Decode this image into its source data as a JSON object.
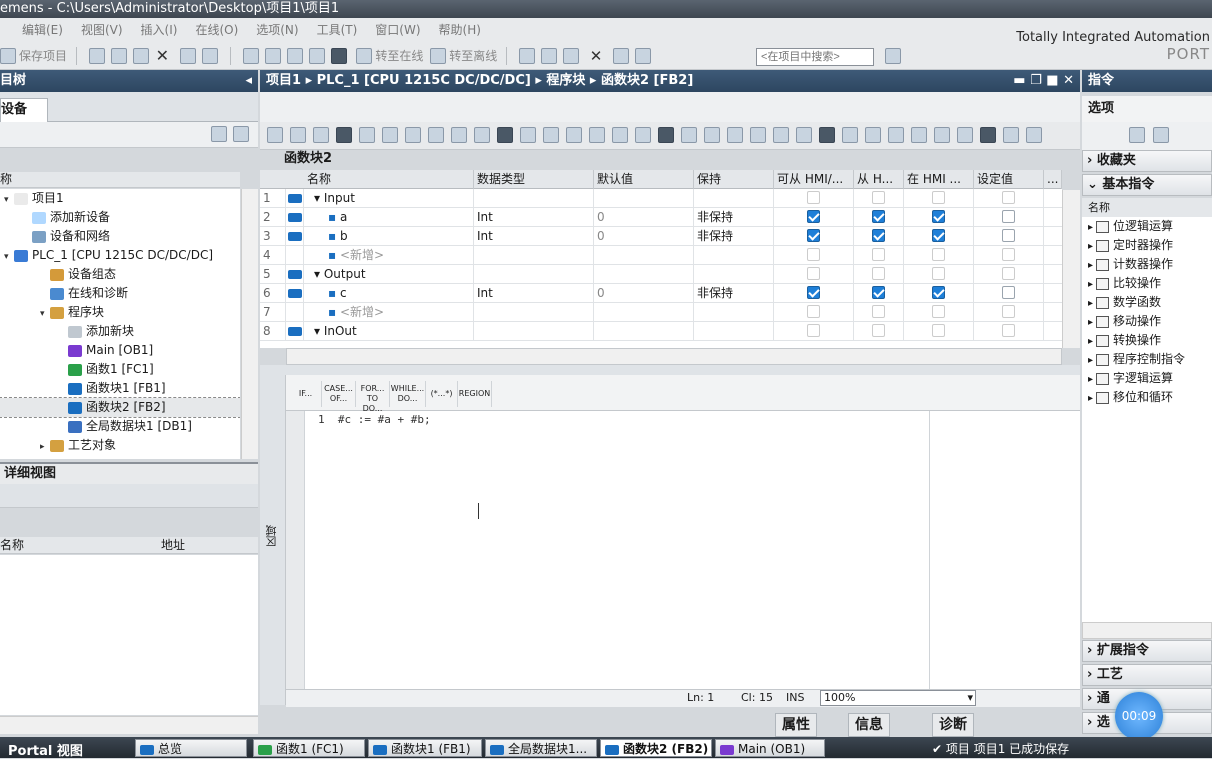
{
  "window": {
    "title": "emens  -  C:\\Users\\Administrator\\Desktop\\项目1\\项目1"
  },
  "menu": [
    "编辑(E)",
    "视图(V)",
    "插入(I)",
    "在线(O)",
    "选项(N)",
    "工具(T)",
    "窗口(W)",
    "帮助(H)"
  ],
  "toolbar": {
    "save_label": "保存项目",
    "go_online": "转至在线",
    "go_offline": "转至离线",
    "search_placeholder": "<在项目中搜索>"
  },
  "brand": {
    "line1": "Totally Integrated Automation",
    "line2": "PORT"
  },
  "left": {
    "header": "目树",
    "tab": "设备",
    "col_name": "称",
    "tree": [
      {
        "label": "项目1"
      },
      {
        "label": "添加新设备"
      },
      {
        "label": "设备和网络"
      },
      {
        "label": "PLC_1 [CPU 1215C DC/DC/DC]"
      },
      {
        "label": "设备组态"
      },
      {
        "label": "在线和诊断"
      },
      {
        "label": "程序块"
      },
      {
        "label": "添加新块"
      },
      {
        "label": "Main [OB1]"
      },
      {
        "label": "函数1 [FC1]"
      },
      {
        "label": "函数块1 [FB1]"
      },
      {
        "label": "函数块2 [FB2]"
      },
      {
        "label": "全局数据块1 [DB1]"
      },
      {
        "label": "工艺对象"
      }
    ],
    "detail": {
      "header": "详细视图",
      "col_name": "名称",
      "col_addr": "地址"
    }
  },
  "editor": {
    "breadcrumb": "项目1 ▸ PLC_1 [CPU 1215C DC/DC/DC] ▸ 程序块 ▸ 函数块2 [FB2]",
    "block_title": "函数块2",
    "columns": [
      "名称",
      "数据类型",
      "默认值",
      "保持",
      "可从 HMI/...",
      "从 H...",
      "在 HMI ...",
      "设定值",
      "..."
    ],
    "rows": [
      {
        "n": "1",
        "name": "Input",
        "type": "",
        "def": "",
        "ret": "",
        "c1": false,
        "c2": false,
        "c3": false,
        "sec": true
      },
      {
        "n": "2",
        "name": "a",
        "type": "Int",
        "def": "0",
        "ret": "非保持",
        "c1": true,
        "c2": true,
        "c3": true
      },
      {
        "n": "3",
        "name": "b",
        "type": "Int",
        "def": "0",
        "ret": "非保持",
        "c1": true,
        "c2": true,
        "c3": true
      },
      {
        "n": "4",
        "name": "<新增>",
        "type": "",
        "def": "",
        "ret": "",
        "c1": false,
        "c2": false,
        "c3": false,
        "add": true
      },
      {
        "n": "5",
        "name": "Output",
        "type": "",
        "def": "",
        "ret": "",
        "c1": false,
        "c2": false,
        "c3": false,
        "sec": true
      },
      {
        "n": "6",
        "name": "c",
        "type": "Int",
        "def": "0",
        "ret": "非保持",
        "c1": true,
        "c2": true,
        "c3": true
      },
      {
        "n": "7",
        "name": "<新增>",
        "type": "",
        "def": "",
        "ret": "",
        "c1": false,
        "c2": false,
        "c3": false,
        "add": true
      },
      {
        "n": "8",
        "name": "InOut",
        "type": "",
        "def": "",
        "ret": "",
        "c1": false,
        "c2": false,
        "c3": false,
        "sec": true
      }
    ],
    "scl_buttons": [
      "IF...",
      "CASE... OF...",
      "FOR... TO DO...",
      "WHILE... DO...",
      "(*...*)",
      "REGION"
    ],
    "code_line_no": "1",
    "code": "#c := #a + #b;",
    "side_label": "区域",
    "status": {
      "ln": "Ln: 1",
      "cl": "Cl: 15",
      "ins": "INS",
      "zoom": "100%"
    },
    "inspector": {
      "props": "属性",
      "info": "信息",
      "diag": "诊断"
    }
  },
  "right": {
    "header": "指令",
    "options": "选项",
    "favorites": "收藏夹",
    "basic": "基本指令",
    "col_name": "名称",
    "items": [
      "位逻辑运算",
      "定时器操作",
      "计数器操作",
      "比较操作",
      "数学函数",
      "移动操作",
      "转换操作",
      "程序控制指令",
      "字逻辑运算",
      "移位和循环"
    ],
    "ext": "扩展指令",
    "tech": "工艺",
    "comm": "通",
    "opt": "选"
  },
  "clock": "00:09",
  "taskbar": {
    "portal": "Portal 视图",
    "overview": "总览",
    "tasks": [
      "函数1 (FC1)",
      "函数块1 (FB1)",
      "全局数据块1...",
      "函数块2 (FB2)",
      "Main (OB1)"
    ],
    "status": "项目 项目1 已成功保存"
  }
}
